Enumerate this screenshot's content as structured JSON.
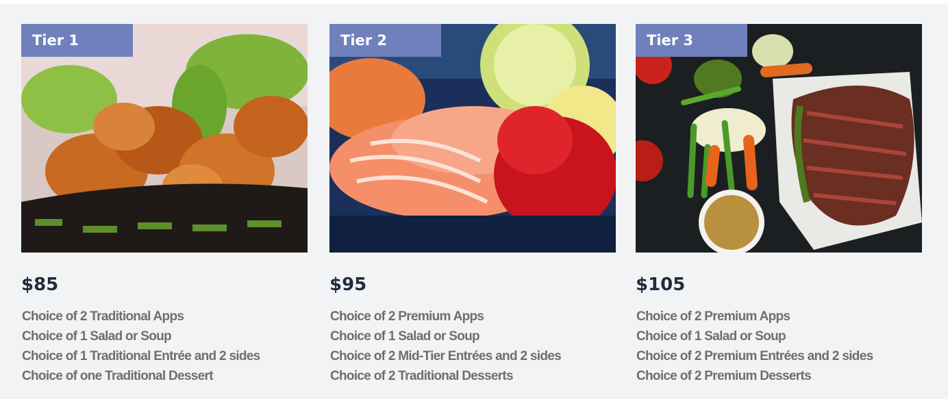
{
  "tiers": [
    {
      "label": "Tier 1",
      "image": "fried-chicken-basket",
      "price": "$85",
      "features": [
        "Choice of 2 Traditional Apps",
        "Choice of 1 Salad or Soup",
        "Choice of 1 Traditional Entrée and 2 sides",
        "Choice of one Traditional Dessert"
      ]
    },
    {
      "label": "Tier 2",
      "image": "salmon-sashimi-plate",
      "price": "$95",
      "features": [
        "Choice of 2 Premium Apps",
        "Choice of 1 Salad or Soup",
        "Choice of 2 Mid-Tier Entrées and 2 sides",
        "Choice of 2  Traditional Desserts"
      ]
    },
    {
      "label": "Tier 3",
      "image": "steak-and-vegetables",
      "price": "$105",
      "features": [
        "Choice of 2 Premium Apps",
        "Choice of 1 Salad or Soup",
        "Choice of 2 Premium Entrées and 2 sides",
        "Choice of 2 Premium Desserts"
      ]
    }
  ],
  "colors": {
    "tier_badge": "#6f80bd",
    "price_text": "#1f2d3d",
    "feature_text": "#6c6e70",
    "panel_background": "#f2f3f5"
  }
}
